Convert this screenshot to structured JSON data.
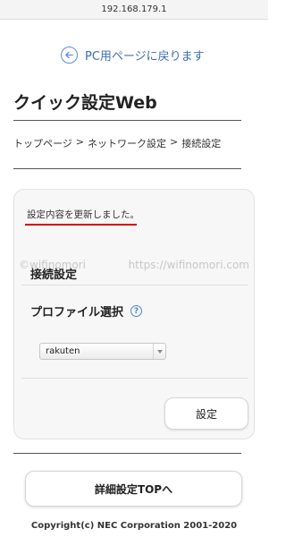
{
  "address_bar": {
    "url": "192.168.179.1"
  },
  "back_link": {
    "label": "PC用ページに戻ります"
  },
  "page_title": "クイック設定Web",
  "breadcrumb": {
    "items": [
      "トップページ",
      "ネットワーク設定",
      "接続設定"
    ],
    "separator": ">"
  },
  "card": {
    "message": "設定内容を更新しました。",
    "section_title": "接続設定",
    "profile_label": "プロファイル選択",
    "help_icon": "?",
    "profile_select": {
      "selected": "rakuten"
    },
    "set_button": "設定"
  },
  "watermark": {
    "left": "©wifinomori",
    "right": "https://wifinomori.com"
  },
  "top_button": "詳細設定TOPへ",
  "copyright": "Copyright(c) NEC Corporation 2001-2020",
  "colors": {
    "link": "#3b6fb6",
    "underline": "#d40000",
    "help": "#4a86d6"
  },
  "icons": {
    "back": "arrow-left-circle-icon",
    "help": "question-circle-icon",
    "select": "chevron-down-icon"
  }
}
